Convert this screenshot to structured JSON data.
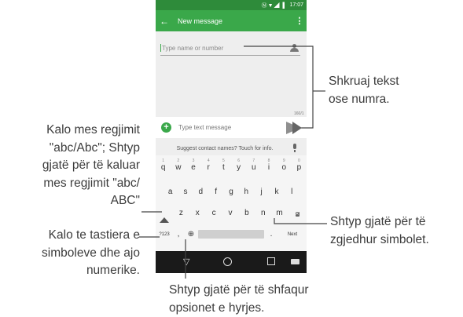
{
  "status_bar": {
    "icons": "Ⓝ▼◢ ▌",
    "time": "17:07"
  },
  "app_bar": {
    "title": "New message"
  },
  "recipient": {
    "placeholder": "Type name or number"
  },
  "char_count": "160/1",
  "compose": {
    "placeholder": "Type text message"
  },
  "suggestion": {
    "text": "Suggest contact names? Touch for info."
  },
  "keyboard": {
    "row1": [
      {
        "key": "q",
        "num": "1"
      },
      {
        "key": "w",
        "num": "2"
      },
      {
        "key": "e",
        "num": "3"
      },
      {
        "key": "r",
        "num": "4"
      },
      {
        "key": "t",
        "num": "5"
      },
      {
        "key": "y",
        "num": "6"
      },
      {
        "key": "u",
        "num": "7"
      },
      {
        "key": "i",
        "num": "8"
      },
      {
        "key": "o",
        "num": "9"
      },
      {
        "key": "p",
        "num": "0"
      }
    ],
    "row2": [
      "a",
      "s",
      "d",
      "f",
      "g",
      "h",
      "j",
      "k",
      "l"
    ],
    "row3": [
      "z",
      "x",
      "c",
      "v",
      "b",
      "n",
      "m"
    ],
    "symbols_key": "?123",
    "comma_key": ",",
    "globe_key": "⊕",
    "period_key": ".",
    "next_key": "Next"
  },
  "navbar": {
    "back": "▽"
  },
  "callouts": {
    "right_top": [
      "Shkruaj tekst",
      "ose numra."
    ],
    "right_bottom": [
      "Shtyp gjatë për të",
      "zgjedhur simbolet."
    ],
    "left_top": [
      "Kalo mes regjimit",
      "\"abc/Abc\";  Shtyp",
      "gjatë për të kaluar",
      "mes regjimit \"abc/",
      "ABC\""
    ],
    "left_bottom": [
      "Kalo te tastiera e",
      "simboleve dhe ajo",
      "numerike."
    ],
    "bottom": [
      "Shtyp gjatë për të shfaqur",
      "opsionet e hyrjes."
    ]
  },
  "colors": {
    "status_bar": "#2e8b3a",
    "app_bar": "#3aa84a",
    "navbar": "#1a1a1a",
    "leader": "#444444"
  }
}
